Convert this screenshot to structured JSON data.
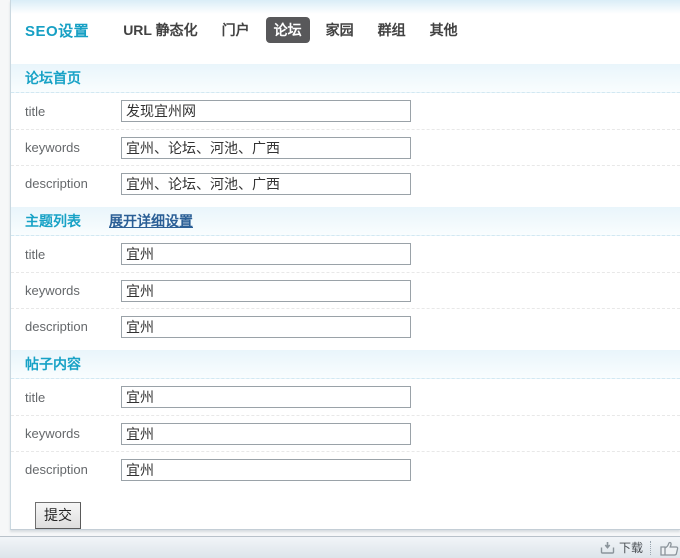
{
  "header": {
    "title": "SEO设置",
    "tabs": [
      {
        "label": "URL 静态化",
        "active": false
      },
      {
        "label": "门户",
        "active": false
      },
      {
        "label": "论坛",
        "active": true
      },
      {
        "label": "家园",
        "active": false
      },
      {
        "label": "群组",
        "active": false
      },
      {
        "label": "其他",
        "active": false
      }
    ]
  },
  "sections": [
    {
      "title": "论坛首页",
      "fields": [
        {
          "label": "title",
          "value": "发现宜州网"
        },
        {
          "label": "keywords",
          "value": "宜州、论坛、河池、广西"
        },
        {
          "label": "description",
          "value": "宜州、论坛、河池、广西"
        }
      ]
    },
    {
      "title": "主题列表",
      "link": "展开详细设置",
      "fields": [
        {
          "label": "title",
          "value": "宜州"
        },
        {
          "label": "keywords",
          "value": "宜州"
        },
        {
          "label": "description",
          "value": "宜州"
        }
      ]
    },
    {
      "title": "帖子内容",
      "fields": [
        {
          "label": "title",
          "value": "宜州"
        },
        {
          "label": "keywords",
          "value": "宜州"
        },
        {
          "label": "description",
          "value": "宜州"
        }
      ]
    }
  ],
  "submit_label": "提交",
  "footer": {
    "download_label": "下载",
    "icons": [
      "download-icon",
      "thumbs-up-icon"
    ]
  },
  "colors": {
    "accent_teal": "#18a2c6",
    "link_blue": "#2b5f96",
    "tab_active_bg": "#58585a",
    "section_bar_bg": "#e9f5fb",
    "statusbar_bg": "#dde4ea"
  }
}
